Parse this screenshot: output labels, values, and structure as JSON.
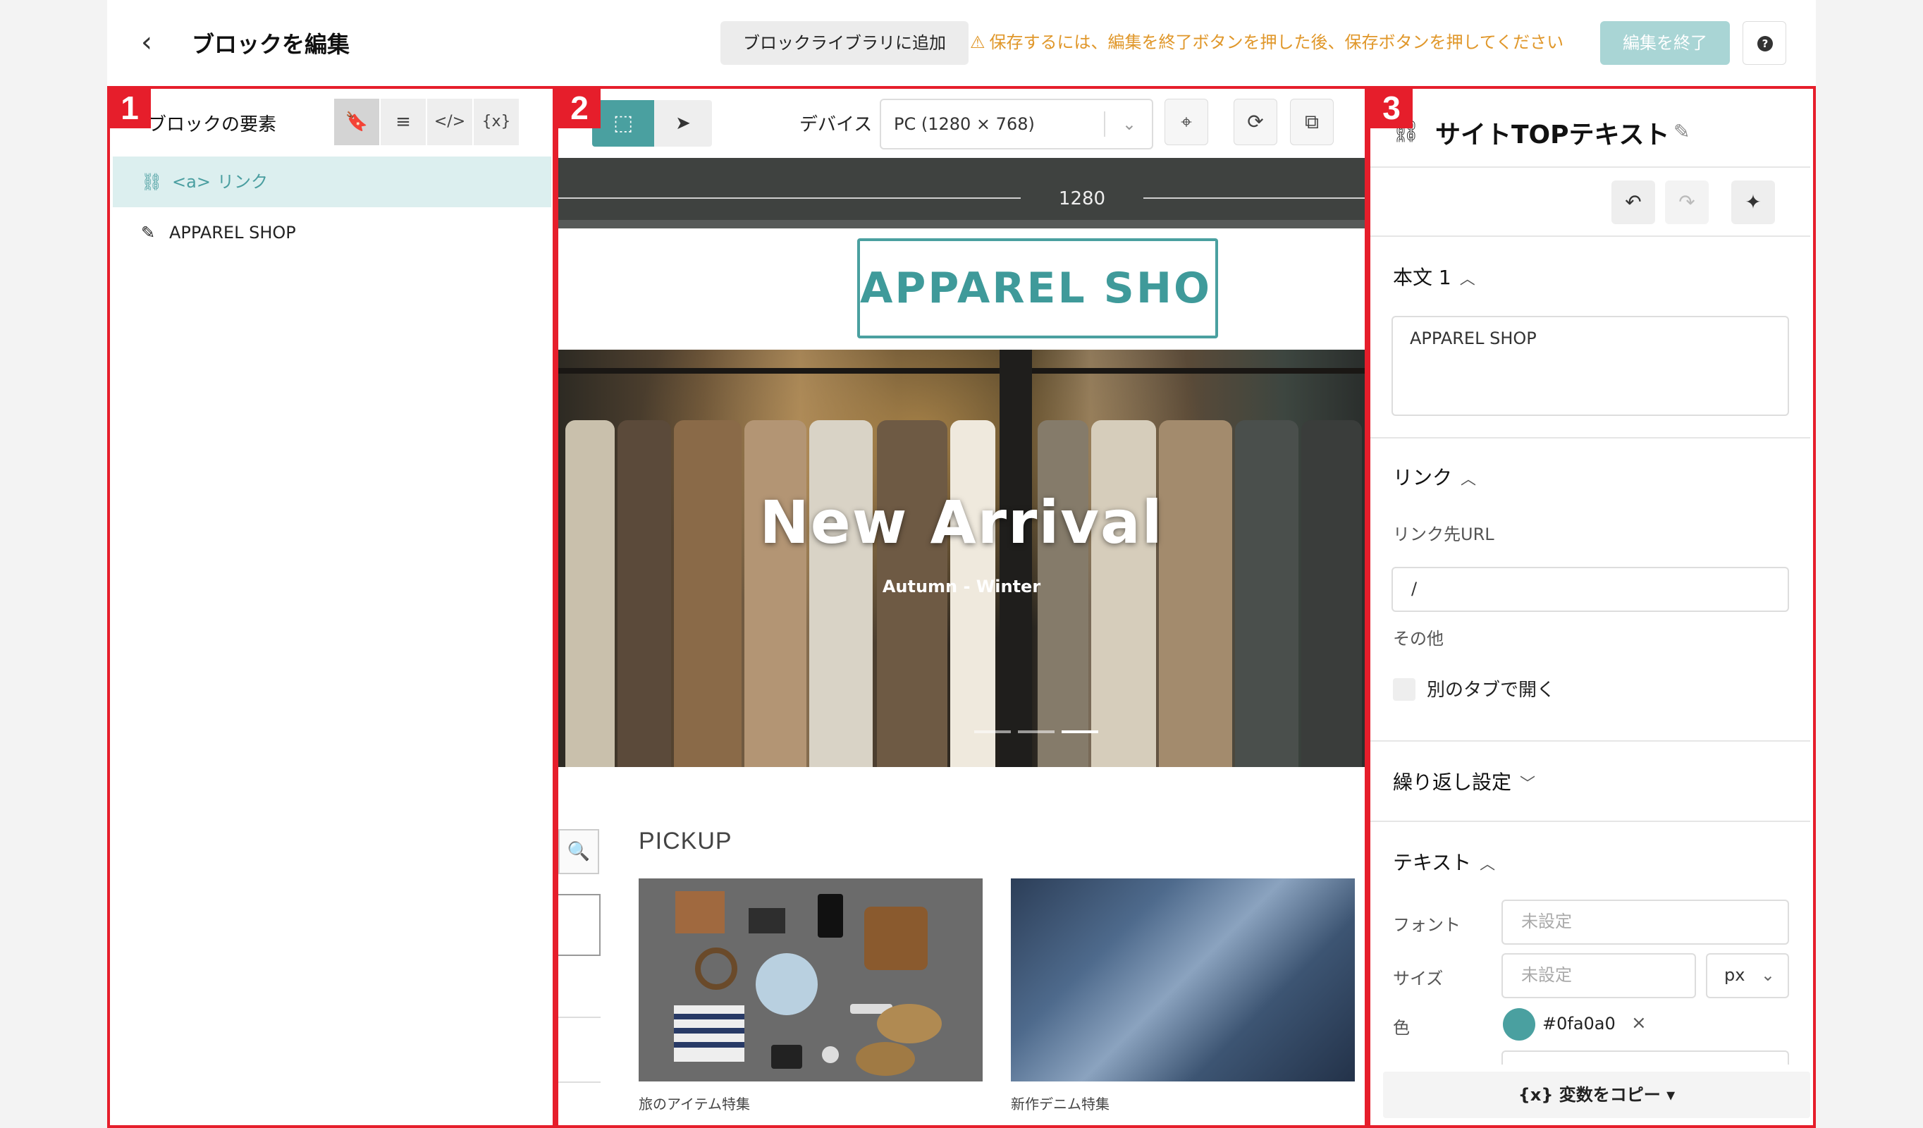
{
  "header": {
    "back_icon": "chevron-left-icon",
    "title": "ブロックを編集",
    "add_to_library": "ブロックライブラリに追加",
    "warning": "保存するには、編集を終了ボタンを押した後、保存ボタンを押してください",
    "finish_button": "編集を終了",
    "help": "?"
  },
  "markers": [
    "1",
    "2",
    "3"
  ],
  "panel1": {
    "title": "ブロックの要素",
    "tools": [
      "bookmark-icon",
      "list-icon",
      "code-icon",
      "variable-icon"
    ],
    "tool_glyphs": [
      "🔖",
      "≡",
      "</>",
      "{x}"
    ],
    "elements": [
      {
        "tag": "<a>",
        "label": "リンク",
        "icon": "link-icon",
        "selected": true
      },
      {
        "tag": "",
        "label": "APPAREL SHOP",
        "icon": "pencil-icon",
        "selected": false
      }
    ]
  },
  "panel2": {
    "device_label": "デバイス",
    "device_value": "PC (1280 × 768)",
    "ruler_width": "1280",
    "preview": {
      "logo": "APPAREL SHOP",
      "hero_title": "New Arrival",
      "hero_subtitle": "Autumn - Winter",
      "pickup_title": "PICKUP",
      "cards": [
        "旅のアイテム特集",
        "新作デニム特集"
      ]
    }
  },
  "panel3": {
    "title": "サイトTOPテキスト",
    "body_section": "本文 1",
    "body_text": "APPAREL SHOP",
    "link_section": "リンク",
    "link_url_label": "リンク先URL",
    "link_url_value": "/",
    "other_label": "その他",
    "new_tab_label": "別のタブで開く",
    "repeat_section": "繰り返し設定",
    "text_section": "テキスト",
    "font_label": "フォント",
    "font_placeholder": "未設定",
    "size_label": "サイズ",
    "size_placeholder": "未設定",
    "size_unit": "px",
    "color_label": "色",
    "color_value": "#0fa0a0",
    "copy_button": "変数をコピー"
  },
  "colors": {
    "accent": "#4aa0a0",
    "warning": "#e0972a",
    "marker_red": "#e61e2b",
    "finish_button_bg": "#a9d5d5"
  }
}
